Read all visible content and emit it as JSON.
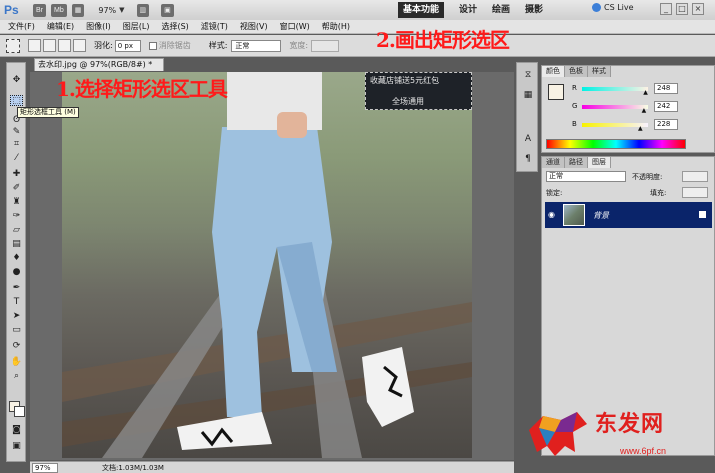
{
  "titlebar": {
    "logo": "Ps",
    "chip_br": "Br",
    "chip_mb": "Mb",
    "zoom": "97%",
    "workspaces": [
      "基本功能",
      "设计",
      "绘画",
      "摄影"
    ],
    "cs_live": "CS Live"
  },
  "menus": [
    "文件(F)",
    "编辑(E)",
    "图像(I)",
    "图层(L)",
    "选择(S)",
    "滤镜(T)",
    "视图(V)",
    "窗口(W)",
    "帮助(H)"
  ],
  "options": {
    "feather_label": "羽化:",
    "feather_value": "0 px",
    "antialias_label": "消除锯齿",
    "style_label": "样式:",
    "style_value": "正常",
    "width_label": "宽度:"
  },
  "tooltip": "矩形选框工具 (M)",
  "document": {
    "tab_title": "去水印.jpg @ 97%(RGB/8#) *"
  },
  "promo": {
    "line1": "收藏店铺送5元红包",
    "line2": "全场通用"
  },
  "annotations": {
    "step1": "1.选择矩形选区工具",
    "step2": "2.画出矩形选区"
  },
  "status": {
    "zoom": "97%",
    "doc_info": "文档:1.03M/1.03M"
  },
  "color_panel": {
    "tabs": [
      "颜色",
      "色板",
      "样式"
    ],
    "channels": [
      {
        "label": "R",
        "value": "248",
        "level": 0.973
      },
      {
        "label": "G",
        "value": "242",
        "level": 0.949
      },
      {
        "label": "B",
        "value": "228",
        "level": 0.894
      }
    ],
    "foreground": "#f8f2e4"
  },
  "layers_panel": {
    "tabs": [
      "通道",
      "路径",
      "图层"
    ],
    "blend_mode": "正常",
    "opacity_label": "不透明度:",
    "lock_label": "锁定:",
    "fill_label": "填充:",
    "layer_name": "背景"
  },
  "watermark": {
    "brand": "东发网",
    "url": "www.6pf.cn"
  },
  "colors": {
    "annotation": "#ff1a1a",
    "selected_layer": "#0a246a",
    "brand_red": "#e0201e"
  }
}
